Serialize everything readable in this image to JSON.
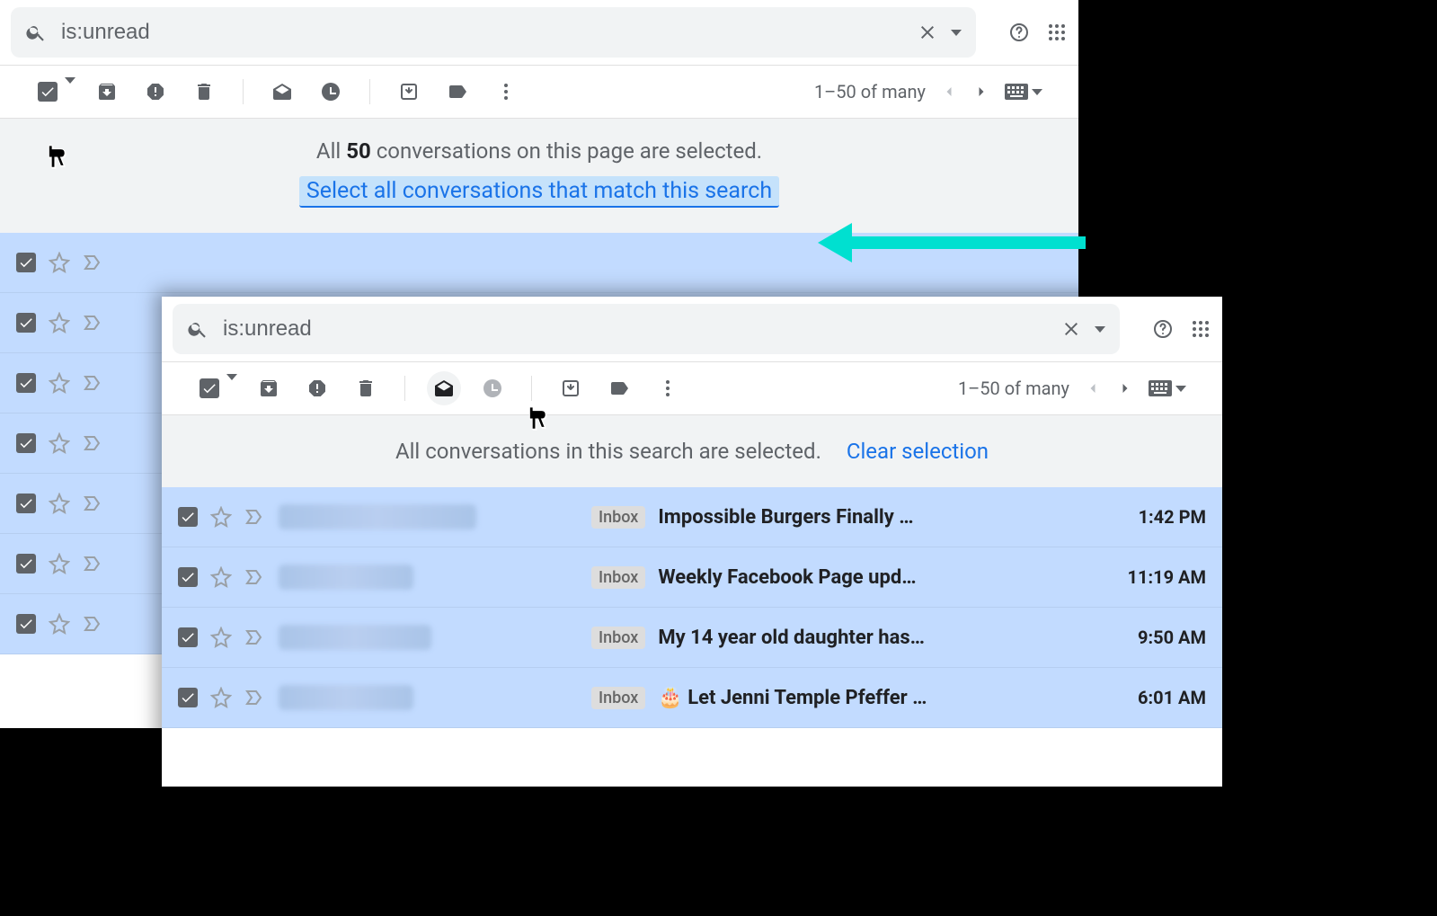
{
  "search": {
    "query": "is:unread"
  },
  "pager": {
    "text": "1–50 of many"
  },
  "banner1": {
    "prefix": "All ",
    "count": "50",
    "suffix": " conversations on this page are selected.",
    "link": "Select all conversations that match this search"
  },
  "banner2": {
    "text": "All conversations in this search are selected.",
    "clear": "Clear selection"
  },
  "inbox_label": "Inbox",
  "emails": [
    {
      "subject": "Impossible Burgers Finally …",
      "time": "1:42 PM"
    },
    {
      "subject": "Weekly Facebook Page upd…",
      "time": "11:19 AM"
    },
    {
      "subject": "My 14 year old daughter has…",
      "time": "9:50 AM"
    },
    {
      "subject": "🎂 Let Jenni Temple Pfeffer …",
      "time": "6:01 AM"
    }
  ]
}
